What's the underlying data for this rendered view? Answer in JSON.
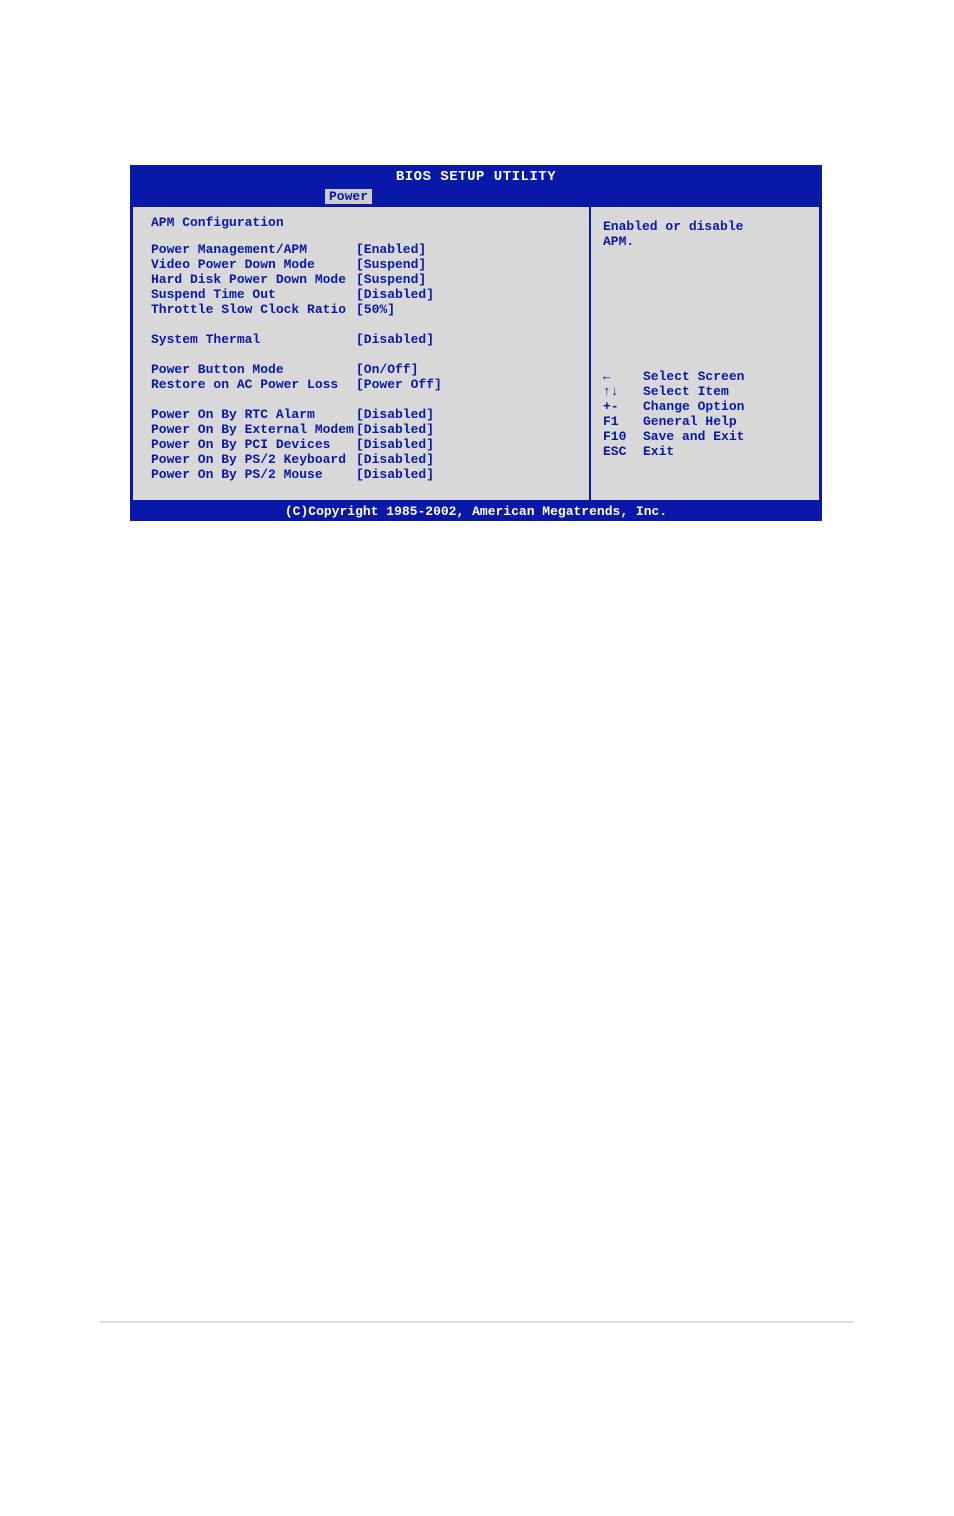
{
  "title": "BIOS SETUP UTILITY",
  "active_tab": "Power",
  "section_header": "APM Configuration",
  "settings": [
    {
      "label": "Power Management/APM",
      "value": "[Enabled]"
    },
    {
      "label": "Video Power Down Mode",
      "value": "[Suspend]"
    },
    {
      "label": "Hard Disk Power Down Mode",
      "value": "[Suspend]"
    },
    {
      "label": "Suspend Time Out",
      "value": "[Disabled]"
    },
    {
      "label": "Throttle Slow Clock Ratio",
      "value": "[50%]"
    }
  ],
  "settings2": [
    {
      "label": "System Thermal",
      "value": "[Disabled]"
    }
  ],
  "settings3": [
    {
      "label": "Power Button Mode",
      "value": "[On/Off]"
    },
    {
      "label": "Restore on AC Power Loss",
      "value": "[Power Off]"
    }
  ],
  "settings4": [
    {
      "label": "Power On By RTC Alarm",
      "value": "[Disabled]"
    },
    {
      "label": "Power On By External Modem",
      "value": "[Disabled]"
    },
    {
      "label": "Power On By PCI Devices",
      "value": "[Disabled]"
    },
    {
      "label": "Power On By PS/2 Keyboard",
      "value": "[Disabled]"
    },
    {
      "label": "Power On By PS/2 Mouse",
      "value": "[Disabled]"
    }
  ],
  "help_text_line1": "Enabled or disable",
  "help_text_line2": "APM.",
  "nav_keys": [
    {
      "key": "←",
      "desc": "Select Screen"
    },
    {
      "key": "↑↓",
      "desc": "Select Item"
    },
    {
      "key": "+-",
      "desc": "Change Option"
    },
    {
      "key": "F1",
      "desc": "General Help"
    },
    {
      "key": "F10",
      "desc": "Save and Exit"
    },
    {
      "key": "ESC",
      "desc": "Exit"
    }
  ],
  "copyright": "(C)Copyright 1985-2002, American Megatrends, Inc."
}
